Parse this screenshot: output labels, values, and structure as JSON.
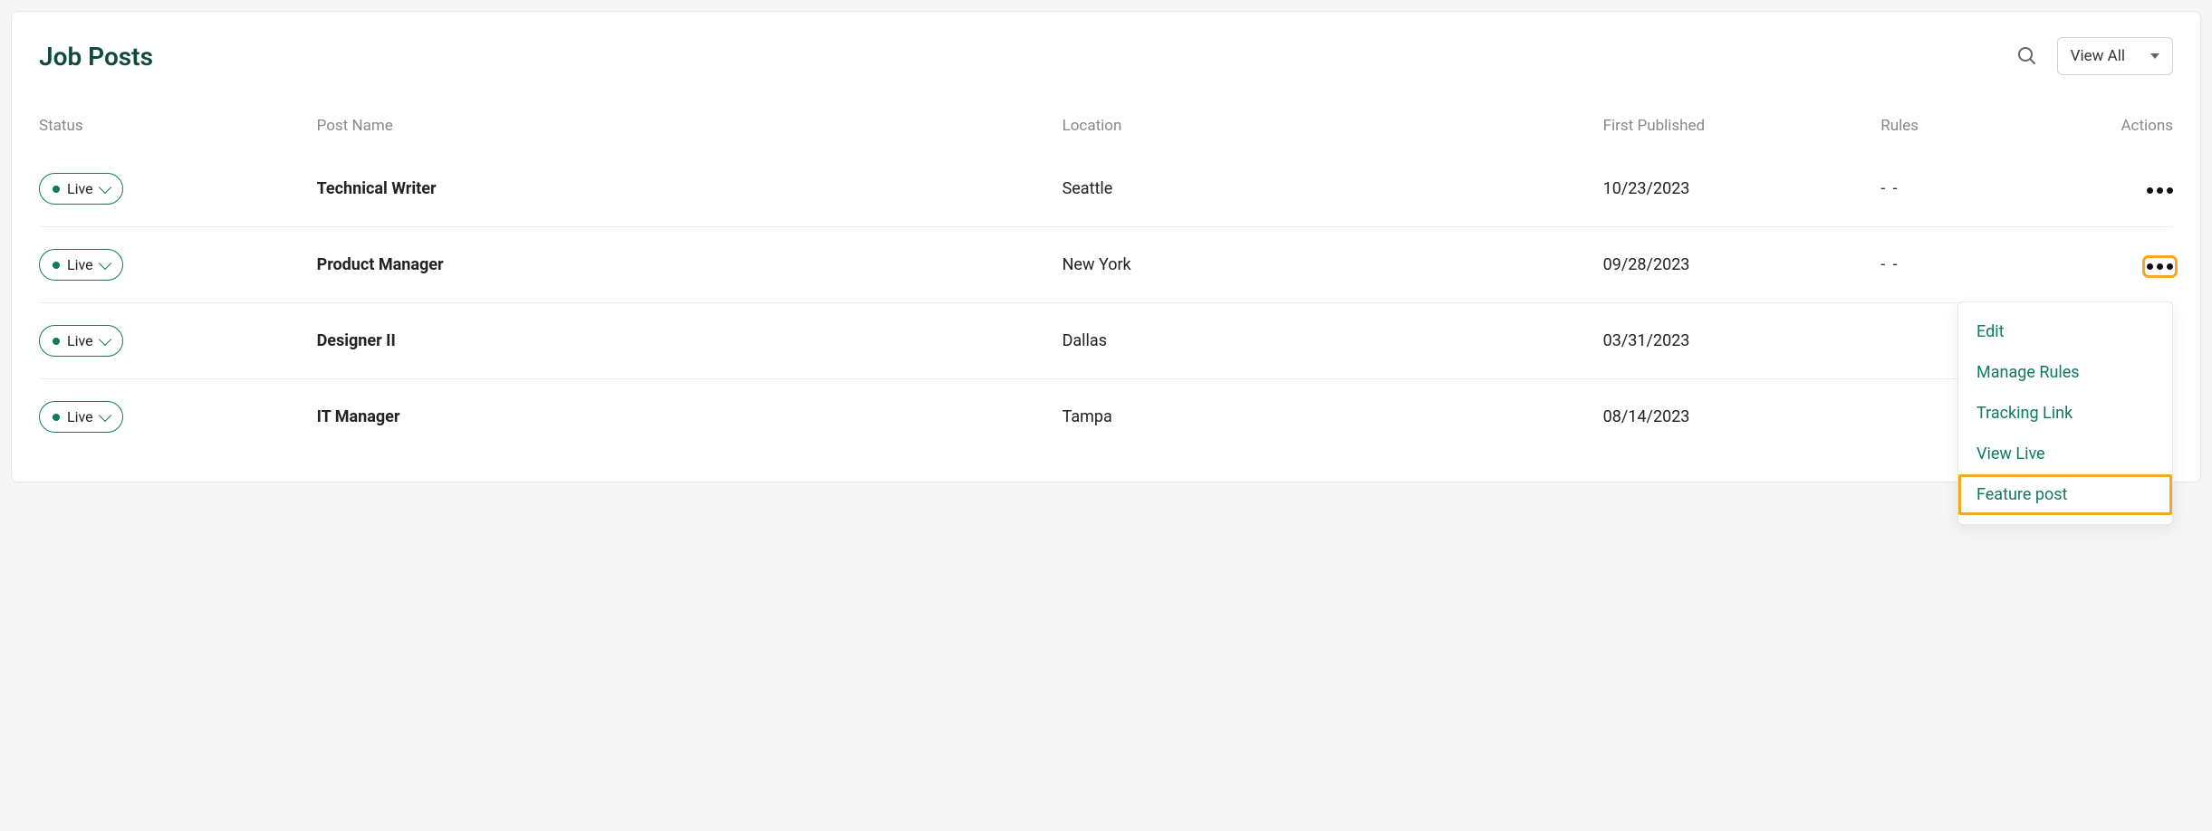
{
  "header": {
    "title": "Job Posts",
    "filter_label": "View All"
  },
  "columns": {
    "status": "Status",
    "post_name": "Post Name",
    "location": "Location",
    "first_published": "First Published",
    "rules": "Rules",
    "actions": "Actions"
  },
  "rows": [
    {
      "status": "Live",
      "post_name": "Technical Writer",
      "location": "Seattle",
      "first_published": "10/23/2023",
      "rules": "- -"
    },
    {
      "status": "Live",
      "post_name": "Product Manager",
      "location": "New York",
      "first_published": "09/28/2023",
      "rules": "- -"
    },
    {
      "status": "Live",
      "post_name": "Designer II",
      "location": "Dallas",
      "first_published": "03/31/2023",
      "rules": ""
    },
    {
      "status": "Live",
      "post_name": "IT Manager",
      "location": "Tampa",
      "first_published": "08/14/2023",
      "rules": ""
    }
  ],
  "actions_menu": {
    "edit": "Edit",
    "manage_rules": "Manage Rules",
    "tracking_link": "Tracking Link",
    "view_live": "View Live",
    "feature_post": "Feature post"
  }
}
